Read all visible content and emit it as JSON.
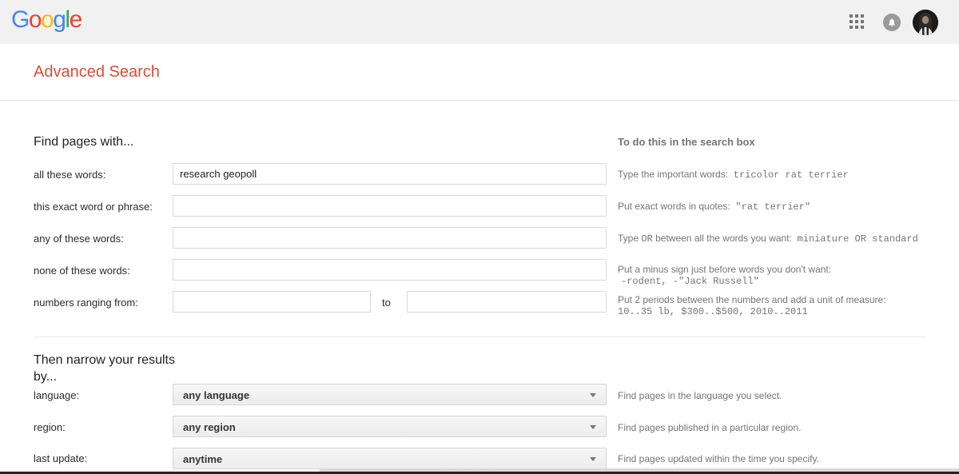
{
  "topbar": {
    "logo_letters": [
      {
        "ch": "G",
        "color": "#4285F4"
      },
      {
        "ch": "o",
        "color": "#EA4335"
      },
      {
        "ch": "o",
        "color": "#FBBC05"
      },
      {
        "ch": "g",
        "color": "#4285F4"
      },
      {
        "ch": "l",
        "color": "#34A853"
      },
      {
        "ch": "e",
        "color": "#EA4335"
      }
    ],
    "icons": {
      "apps": "apps-grid-icon",
      "notifications": "notification-bell-icon",
      "avatar": "user-avatar"
    },
    "bg_color": "#f1f1f1"
  },
  "title_bar": {
    "title": "Advanced Search",
    "title_color": "#dd4b39"
  },
  "find_section": {
    "heading": "Find pages with...",
    "hints_heading": "To do this in the search box",
    "rows": [
      {
        "label": "all these words:",
        "value": "research geopoll"
      },
      {
        "label": "this exact word or phrase:",
        "value": ""
      },
      {
        "label": "any of these words:",
        "value": ""
      },
      {
        "label": "none of these words:",
        "value": ""
      },
      {
        "label": "numbers ranging from:",
        "value_from": "",
        "to_label": "to",
        "value_to": ""
      }
    ],
    "hints": [
      {
        "text": "Type the important words:",
        "example": "tricolor rat terrier"
      },
      {
        "text": "Put exact words in quotes:",
        "example": "\"rat terrier\""
      },
      {
        "pre": "Type",
        "mono_mid": "OR",
        "post": "between all the words you want:",
        "example": "miniature OR standard"
      },
      {
        "text": "Put a minus sign just before words you don't want:",
        "example": "-rodent, -\"Jack Russell\""
      },
      {
        "text": "Put 2 periods between the numbers and add a unit of measure:",
        "example": "10..35 lb, $300..$500, 2010..2011"
      }
    ]
  },
  "narrow_section": {
    "heading": "Then narrow your results by...",
    "rows": [
      {
        "label": "language:",
        "value": "any language",
        "description": "Find pages in the language you select."
      },
      {
        "label": "region:",
        "value": "any region",
        "description": "Find pages published in a particular region."
      },
      {
        "label": "last update:",
        "value": "anytime",
        "description": "Find pages updated within the time you specify."
      }
    ]
  }
}
